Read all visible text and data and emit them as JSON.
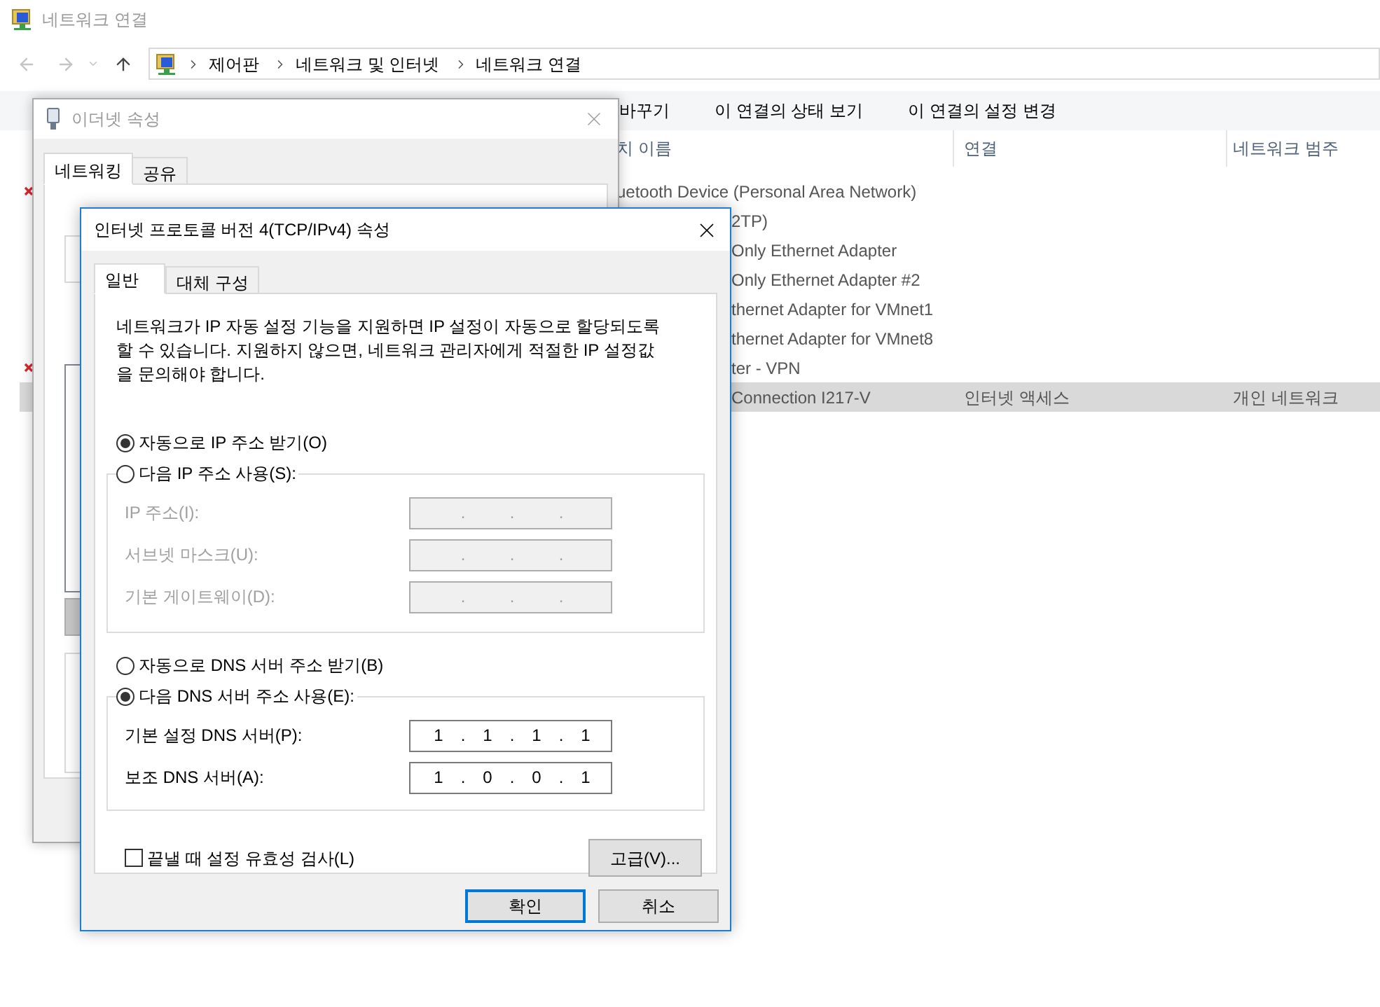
{
  "explorer": {
    "title": "네트워크 연결",
    "breadcrumb": [
      "제어판",
      "네트워크 및 인터넷",
      "네트워크 연결"
    ],
    "toolbar": [
      "바꾸기",
      "이 연결의 상태 보기",
      "이 연결의 설정 변경"
    ],
    "columns": [
      "치 이름",
      "연결",
      "네트워크 범주"
    ],
    "rows": [
      {
        "name": "uetooth Device (Personal Area Network)",
        "disconnected": true,
        "selected": false
      },
      {
        "name": "2TP)",
        "disconnected": false,
        "selected": false
      },
      {
        "name": "Only Ethernet Adapter",
        "disconnected": false,
        "selected": false
      },
      {
        "name": "Only Ethernet Adapter #2",
        "disconnected": false,
        "selected": false
      },
      {
        "name": "thernet Adapter for VMnet1",
        "disconnected": false,
        "selected": false
      },
      {
        "name": "thernet Adapter for VMnet8",
        "disconnected": false,
        "selected": false
      },
      {
        "name": "ter - VPN",
        "disconnected": true,
        "selected": false
      },
      {
        "name": "Connection I217-V",
        "connection": "인터넷 액세스",
        "category": "개인 네트워크",
        "disconnected": false,
        "selected": true
      }
    ]
  },
  "ethernet_dialog": {
    "title": "이더넷 속성",
    "tabs": [
      {
        "label": "네트워킹",
        "selected": true
      },
      {
        "label": "공유",
        "selected": false
      }
    ]
  },
  "ipv4_dialog": {
    "title": "인터넷 프로토콜 버전 4(TCP/IPv4) 속성",
    "tabs": [
      {
        "label": "일반",
        "selected": true
      },
      {
        "label": "대체 구성",
        "selected": false
      }
    ],
    "description": "네트워크가 IP 자동 설정 기능을 지원하면 IP 설정이 자동으로 할당되도록 할 수 있습니다. 지원하지 않으면, 네트워크 관리자에게 적절한 IP 설정값을 문의해야 합니다.",
    "separator": ".",
    "ip_auto": {
      "label": "자동으로 IP 주소 받기(O)",
      "selected": true
    },
    "ip_manual": {
      "label": "다음 IP 주소 사용(S):",
      "selected": false
    },
    "ip_fields": [
      {
        "label": "IP 주소(I):",
        "disabled": true
      },
      {
        "label": "서브넷 마스크(U):",
        "disabled": true
      },
      {
        "label": "기본 게이트웨이(D):",
        "disabled": true
      }
    ],
    "dns_auto": {
      "label": "자동으로 DNS 서버 주소 받기(B)",
      "selected": false
    },
    "dns_manual": {
      "label": "다음 DNS 서버 주소 사용(E):",
      "selected": true
    },
    "dns_fields": [
      {
        "label": "기본 설정 DNS 서버(P):",
        "disabled": false,
        "octets": [
          "1",
          "1",
          "1",
          "1"
        ]
      },
      {
        "label": "보조 DNS 서버(A):",
        "disabled": false,
        "octets": [
          "1",
          "0",
          "0",
          "1"
        ]
      }
    ],
    "validate": {
      "label": "끝낼 때 설정 유효성 검사(L)",
      "checked": false
    },
    "advanced_button": "고급(V)...",
    "buttons": [
      {
        "label": "확인",
        "default": true
      },
      {
        "label": "취소",
        "default": false
      }
    ]
  }
}
